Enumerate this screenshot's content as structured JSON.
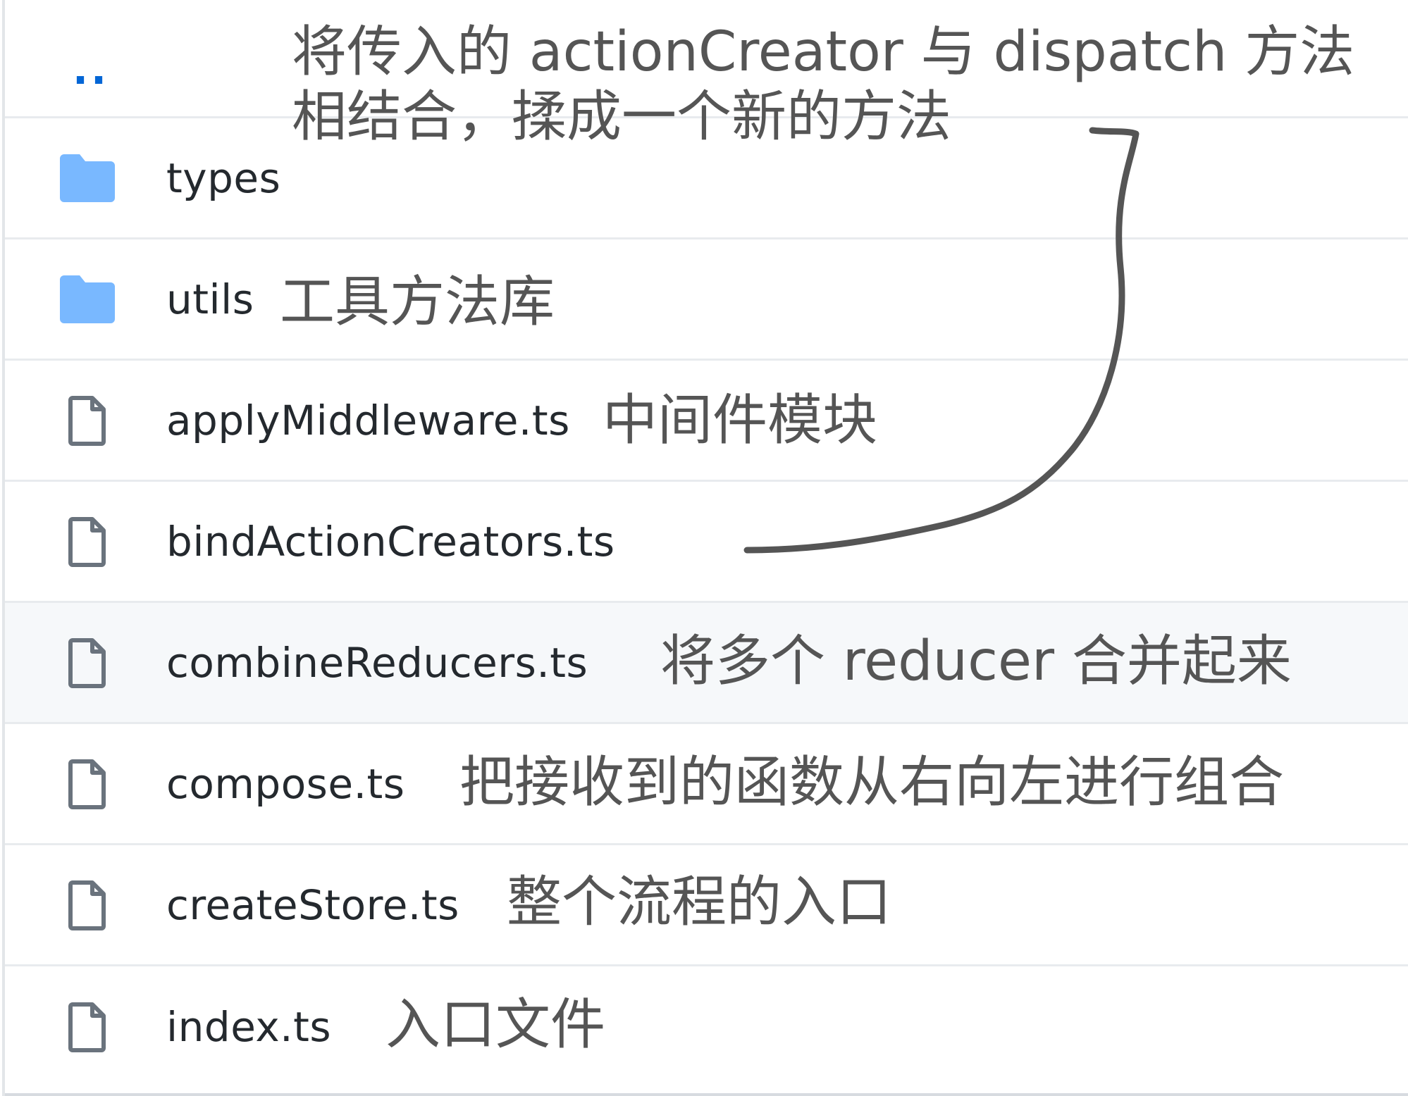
{
  "parent_link": "..",
  "annotation_top": {
    "line1": "将传入的 actionCreator 与 dispatch 方法",
    "line2": "相结合，揉成一个新的方法"
  },
  "files": [
    {
      "name": "types",
      "type": "folder",
      "note": ""
    },
    {
      "name": "utils",
      "type": "folder",
      "note": "工具方法库"
    },
    {
      "name": "applyMiddleware.ts",
      "type": "file",
      "note": "中间件模块"
    },
    {
      "name": "bindActionCreators.ts",
      "type": "file",
      "note": ""
    },
    {
      "name": "combineReducers.ts",
      "type": "file",
      "note": "将多个 reducer 合并起来"
    },
    {
      "name": "compose.ts",
      "type": "file",
      "note": "把接收到的函数从右向左进行组合"
    },
    {
      "name": "createStore.ts",
      "type": "file",
      "note": "整个流程的入口"
    },
    {
      "name": "index.ts",
      "type": "file",
      "note": "入口文件"
    }
  ],
  "colors": {
    "folder_icon": "#79b8ff",
    "file_icon": "#6a737d",
    "link": "#0366d6",
    "text": "#24292e",
    "annotation": "#555555",
    "row_highlight": "#f6f8fa"
  }
}
